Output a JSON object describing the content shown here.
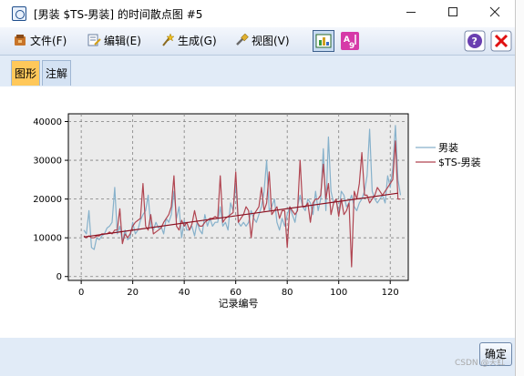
{
  "window": {
    "title": "[男装 $TS-男装] 的时间散点图 #5",
    "minimize_icon": "minimize-icon",
    "maximize_icon": "maximize-icon",
    "close_icon": "close-icon"
  },
  "menu": {
    "file": "文件(F)",
    "edit": "编辑(E)",
    "generate": "生成(G)",
    "view": "视图(V)",
    "help_icon": "help-icon",
    "close_icon": "close-red-icon"
  },
  "tabs": [
    {
      "label": "图形",
      "active": true
    },
    {
      "label": "注解",
      "active": false
    }
  ],
  "ok_button": "确定",
  "watermark": "CSDN @天红",
  "colors": {
    "series_actual": "#86b1cb",
    "series_ts": "#b04450",
    "trend": "#8b1020",
    "plot_bg": "#ebebeb",
    "accent": "#ffc85a"
  },
  "chart_data": {
    "type": "line",
    "title": "",
    "xlabel": "记录编号",
    "ylabel": "",
    "xlim": [
      -5,
      127
    ],
    "ylim": [
      -1000,
      42000
    ],
    "xticks": [
      0,
      20,
      40,
      60,
      80,
      100,
      120
    ],
    "yticks": [
      0,
      10000,
      20000,
      30000,
      40000
    ],
    "grid": true,
    "legend_position": "right",
    "series": [
      {
        "name": "男装",
        "x": [
          1,
          2,
          3,
          4,
          5,
          6,
          7,
          8,
          9,
          10,
          11,
          12,
          13,
          14,
          15,
          16,
          17,
          18,
          19,
          20,
          21,
          22,
          23,
          24,
          25,
          26,
          27,
          28,
          29,
          30,
          31,
          32,
          33,
          34,
          35,
          36,
          37,
          38,
          39,
          40,
          41,
          42,
          43,
          44,
          45,
          46,
          47,
          48,
          49,
          50,
          51,
          52,
          53,
          54,
          55,
          56,
          57,
          58,
          59,
          60,
          61,
          62,
          63,
          64,
          65,
          66,
          67,
          68,
          69,
          70,
          71,
          72,
          73,
          74,
          75,
          76,
          77,
          78,
          79,
          80,
          81,
          82,
          83,
          84,
          85,
          86,
          87,
          88,
          89,
          90,
          91,
          92,
          93,
          94,
          95,
          96,
          97,
          98,
          99,
          100,
          101,
          102,
          103,
          104,
          105,
          106,
          107,
          108,
          109,
          110,
          111,
          112,
          113,
          114,
          115,
          116,
          117,
          118,
          119,
          120,
          121,
          122,
          123,
          124
        ],
        "values": [
          12000,
          11000,
          17000,
          7500,
          7000,
          10000,
          9500,
          10500,
          11000,
          12500,
          13000,
          14000,
          23000,
          11000,
          13000,
          9000,
          12000,
          9500,
          10000,
          14000,
          11000,
          12000,
          14500,
          16000,
          17000,
          21000,
          13000,
          12000,
          14000,
          12500,
          13000,
          11000,
          15000,
          14000,
          16000,
          22000,
          15000,
          18000,
          10000,
          14500,
          12000,
          12000,
          13000,
          10500,
          14000,
          12000,
          11000,
          16000,
          13000,
          15000,
          13000,
          14000,
          14000,
          18000,
          13000,
          14000,
          12000,
          19000,
          17000,
          24000,
          14000,
          13000,
          14000,
          13000,
          14000,
          17000,
          15000,
          14000,
          16000,
          18000,
          22000,
          30000,
          17000,
          18000,
          20000,
          14000,
          12000,
          15000,
          13000,
          16000,
          18000,
          16000,
          14000,
          18000,
          21000,
          18000,
          17000,
          20000,
          19000,
          16000,
          22000,
          17000,
          20000,
          33000,
          17000,
          36000,
          22000,
          19000,
          20000,
          16000,
          22000,
          21000,
          18000,
          19000,
          21000,
          18000,
          17000,
          19000,
          20000,
          22000,
          26000,
          38000,
          22000,
          20000,
          19000,
          20000,
          21000,
          19000,
          26000,
          23000,
          28000,
          39000,
          25000,
          21000
        ]
      },
      {
        "name": "$TS-男装",
        "x": [
          1,
          2,
          3,
          4,
          5,
          6,
          7,
          8,
          9,
          10,
          11,
          12,
          13,
          14,
          15,
          16,
          17,
          18,
          19,
          20,
          21,
          22,
          23,
          24,
          25,
          26,
          27,
          28,
          29,
          30,
          31,
          32,
          33,
          34,
          35,
          36,
          37,
          38,
          39,
          40,
          41,
          42,
          43,
          44,
          45,
          46,
          47,
          48,
          49,
          50,
          51,
          52,
          53,
          54,
          55,
          56,
          57,
          58,
          59,
          60,
          61,
          62,
          63,
          64,
          65,
          66,
          67,
          68,
          69,
          70,
          71,
          72,
          73,
          74,
          75,
          76,
          77,
          78,
          79,
          80,
          81,
          82,
          83,
          84,
          85,
          86,
          87,
          88,
          89,
          90,
          91,
          92,
          93,
          94,
          95,
          96,
          97,
          98,
          99,
          100,
          101,
          102,
          103,
          104,
          105,
          106,
          107,
          108,
          109,
          110,
          111,
          112,
          113,
          114,
          115,
          116,
          117,
          118,
          119,
          120,
          121,
          122,
          123,
          124
        ],
        "values": [
          10500,
          10000,
          10500,
          10000,
          10000,
          10500,
          10500,
          11000,
          11000,
          11000,
          11500,
          11000,
          12000,
          12000,
          17500,
          8500,
          11000,
          10000,
          11000,
          13000,
          14000,
          14500,
          15000,
          24000,
          13000,
          12000,
          16000,
          11000,
          11500,
          12000,
          12500,
          14000,
          15000,
          16000,
          18000,
          26000,
          13000,
          12000,
          14500,
          13000,
          14000,
          12000,
          13500,
          17000,
          14000,
          13000,
          13000,
          14000,
          14500,
          15000,
          15000,
          15500,
          15000,
          26000,
          14000,
          15000,
          15500,
          16000,
          16500,
          27000,
          14000,
          15000,
          16000,
          18000,
          17000,
          10000,
          16000,
          17000,
          18000,
          23000,
          17000,
          19000,
          27000,
          16000,
          17000,
          18000,
          15000,
          17000,
          17000,
          7500,
          18000,
          17000,
          16000,
          17000,
          30000,
          18000,
          18000,
          19000,
          14000,
          19000,
          20000,
          20000,
          21000,
          29000,
          20000,
          24000,
          16000,
          19000,
          20000,
          15500,
          20000,
          16000,
          17000,
          19000,
          2500,
          22000,
          20000,
          24000,
          32000,
          21000,
          21000,
          19000,
          20000,
          21000,
          23000,
          22000,
          21000,
          22000,
          23000,
          24000,
          25000,
          35000,
          20000,
          20000
        ]
      },
      {
        "name": "",
        "x": [
          1,
          123
        ],
        "values": [
          10200,
          21500
        ]
      }
    ]
  }
}
